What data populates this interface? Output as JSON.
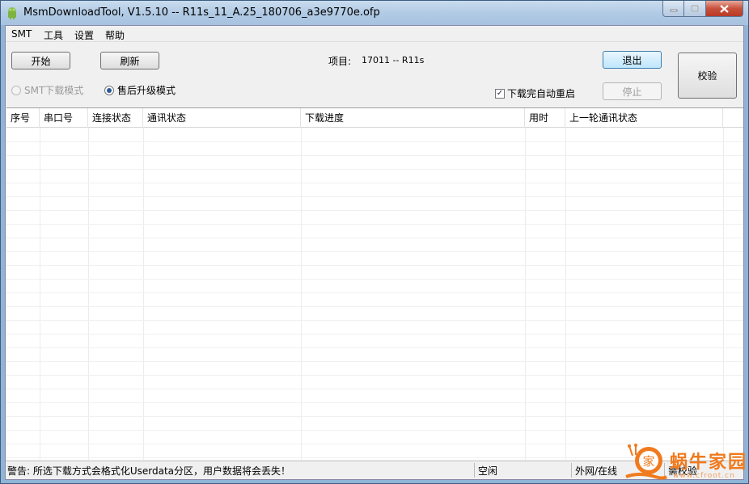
{
  "window": {
    "title": "MsmDownloadTool, V1.5.10 -- R11s_11_A.25_180706_a3e9770e.ofp"
  },
  "menu": [
    "SMT",
    "工具",
    "设置",
    "帮助"
  ],
  "toolbar": {
    "start_label": "开始",
    "refresh_label": "刷新",
    "project_label": "项目:",
    "project_value": "17011 -- R11s",
    "exit_label": "退出",
    "stop_label": "停止",
    "verify_label": "校验",
    "mode_smt_label": "SMT下载模式",
    "mode_aftersale_label": "售后升级模式",
    "selected_mode": "售后升级模式",
    "auto_reboot_label": "下载完自动重启",
    "auto_reboot_checked": true
  },
  "table": {
    "columns": [
      "序号",
      "串口号",
      "连接状态",
      "通讯状态",
      "下载进度",
      "用时",
      "上一轮通讯状态"
    ],
    "rows": []
  },
  "status": {
    "warning": "警告: 所选下载方式会格式化Userdata分区，用户数据将会丢失！",
    "state": "空闲",
    "network": "外网/在线",
    "verify": "需校验"
  },
  "watermark": {
    "text": "蜗牛家园",
    "url": "www.cfroot.cn",
    "logo_char": "家"
  },
  "colors": {
    "titlebar": "#b2cbe5",
    "close_button": "#c8513c",
    "watermark": "#f07a1d"
  },
  "icons": [
    "app-android-icon",
    "minimize-icon",
    "maximize-icon",
    "close-icon",
    "checkmark-icon",
    "snail-logo-icon"
  ]
}
